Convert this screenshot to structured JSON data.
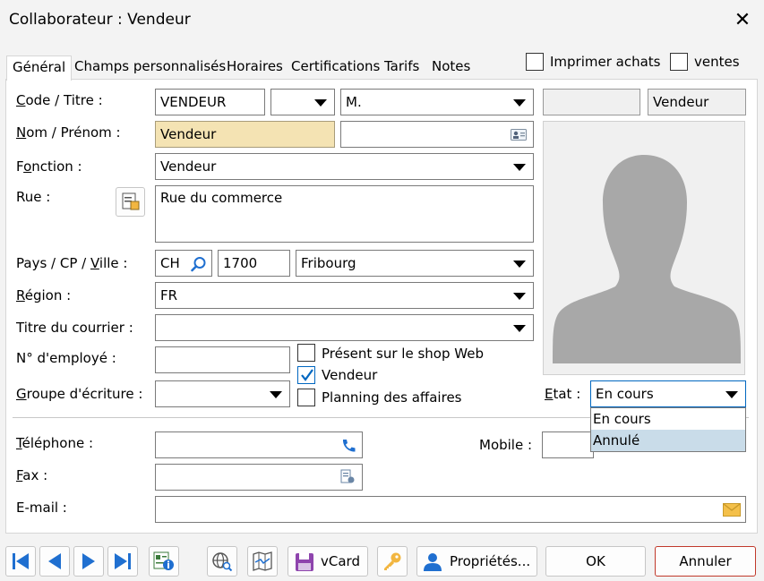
{
  "window": {
    "title": "Collaborateur : Vendeur",
    "close_glyph": "✕"
  },
  "tabs": [
    {
      "label": "Général"
    },
    {
      "label": "Champs personnalisés"
    },
    {
      "label": "Horaires"
    },
    {
      "label": "Certifications"
    },
    {
      "label": "Tarifs"
    },
    {
      "label": "Notes"
    }
  ],
  "top_checks": {
    "print_purchases": {
      "label": "Imprimer achats",
      "checked": false
    },
    "sales": {
      "label": "ventes",
      "checked": false
    }
  },
  "labels": {
    "code_title": {
      "u": "C",
      "rest": "ode / Titre :"
    },
    "name": {
      "u": "N",
      "rest": "om / Prénom :"
    },
    "function": {
      "pre": "F",
      "u": "o",
      "rest": "nction :"
    },
    "street": "Rue :",
    "country": {
      "pre": "Pays / CP / ",
      "u": "V",
      "rest": "ille :"
    },
    "region": {
      "u": "R",
      "rest": "égion :"
    },
    "letter_title": "Titre du courrier :",
    "employee_no": "N° d'employé :",
    "writing_group": {
      "u": "G",
      "rest": "roupe d'écriture :"
    },
    "state": {
      "u": "E",
      "rest": "tat :"
    },
    "phone": {
      "u": "T",
      "rest": "éléphone :"
    },
    "mobile": "Mobile :",
    "fax": {
      "u": "F",
      "rest": "ax :"
    },
    "email": "E-mail :"
  },
  "fields": {
    "code": "VENDEUR",
    "code_extra": "",
    "title": "M.",
    "grey_box": "",
    "title_right": "Vendeur",
    "last_name": "Vendeur",
    "first_name": "",
    "function": "Vendeur",
    "street": "Rue du commerce",
    "country": "CH",
    "postal_code": "1700",
    "city": "Fribourg",
    "region": "FR",
    "letter_title": "",
    "employee_no": "",
    "writing_group": "",
    "state": "En cours",
    "phone": "",
    "mobile": "",
    "fax": "",
    "email": ""
  },
  "flags": [
    {
      "label": "Présent sur le shop Web",
      "checked": false
    },
    {
      "label": "Vendeur",
      "checked": true
    },
    {
      "label": "Planning des affaires",
      "checked": false
    }
  ],
  "state_options": [
    {
      "label": "En cours",
      "selected": false
    },
    {
      "label": "Annulé",
      "selected": true
    }
  ],
  "buttons": {
    "vcard": "vCard",
    "properties": "Propriétés...",
    "ok": "OK",
    "cancel": "Annuler"
  },
  "colors": {
    "accent": "#0067c0",
    "name_field": "#f4e3b3",
    "nav_blue": "#1f6fd0",
    "cancel_border": "#c0392b"
  },
  "icons": [
    "search-icon",
    "contact-card-icon",
    "address-book-icon",
    "phone-icon",
    "fax-icon",
    "mail-icon",
    "silhouette-icon",
    "first-icon",
    "previous-icon",
    "next-icon",
    "last-icon",
    "info-card-icon",
    "web-search-icon",
    "map-icon",
    "save-icon",
    "key-icon",
    "user-icon"
  ]
}
